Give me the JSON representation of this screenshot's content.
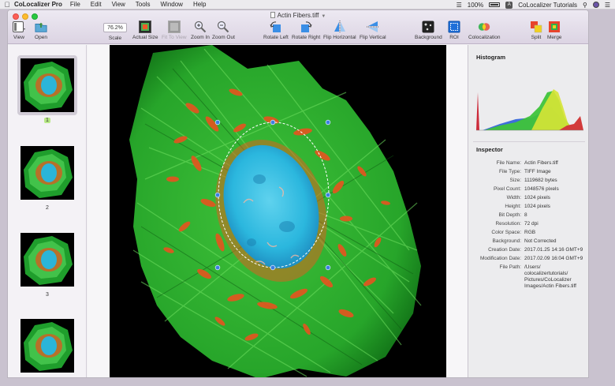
{
  "menubar": {
    "apple": "",
    "app_name": "CoLocalizer Pro",
    "menus": [
      "File",
      "Edit",
      "View",
      "Tools",
      "Window",
      "Help"
    ],
    "battery": "100%",
    "badge": "A",
    "user": "CoLocalizer Tutorials"
  },
  "window": {
    "title": "Actin Fibers.tiff"
  },
  "toolbar": {
    "view_label": "View",
    "open_label": "Open",
    "scale_value": "76.2%",
    "scale_label": "Scale",
    "actual_size_label": "Actual Size",
    "fit_to_view_label": "Fit To View",
    "zoom_in_label": "Zoom In",
    "zoom_out_label": "Zoom Out",
    "rotate_left_label": "Rotate Left",
    "rotate_right_label": "Rotate Right",
    "flip_horizontal_label": "Flip Horizontal",
    "flip_vertical_label": "Flip Vertical",
    "background_label": "Background",
    "roi_label": "ROI",
    "colocalization_label": "Colocalization",
    "split_label": "Split",
    "merge_label": "Merge"
  },
  "thumbnails": [
    {
      "label": "1",
      "selected": true
    },
    {
      "label": "2",
      "selected": false
    },
    {
      "label": "3",
      "selected": false
    },
    {
      "label": "",
      "selected": false
    }
  ],
  "histogram": {
    "title": "Histogram"
  },
  "inspector": {
    "title": "Inspector",
    "rows": [
      {
        "key": "File Name:",
        "value": "Actin Fibers.tiff"
      },
      {
        "key": "File Type:",
        "value": "TIFF Image"
      },
      {
        "key": "Size:",
        "value": "1119682 bytes"
      },
      {
        "key": "Pixel Count:",
        "value": "1048576 pixels"
      },
      {
        "key": "Width:",
        "value": "1024 pixels"
      },
      {
        "key": "Height:",
        "value": "1024 pixels"
      },
      {
        "key": "Bit Depth:",
        "value": "8"
      },
      {
        "key": "Resolution:",
        "value": "72 dpi"
      },
      {
        "key": "Color Space:",
        "value": "RGB"
      },
      {
        "key": "Background:",
        "value": "Not Corrected"
      },
      {
        "key": "Creation Date:",
        "value": "2017.01.25 14:16 GMT+9"
      },
      {
        "key": "Modification Date:",
        "value": "2017.02.09 16:04 GMT+9"
      }
    ],
    "file_path_key": "File Path:",
    "file_path_lines": [
      "/Users/",
      "colocalizertutorials/",
      "Pictures/CoLocalizer",
      "Images/Actin Fibers.tiff"
    ]
  },
  "colors": {
    "accent": "#2f7de1",
    "thumb_selected_badge": "#b8e986"
  }
}
